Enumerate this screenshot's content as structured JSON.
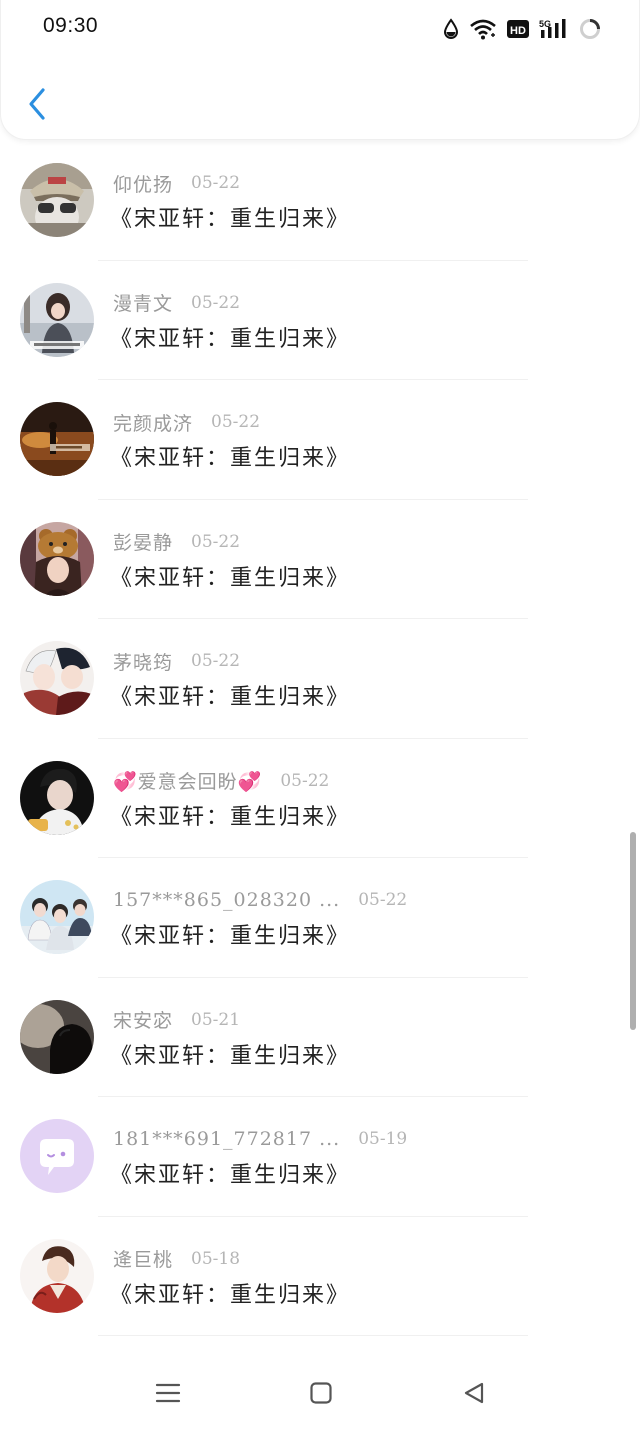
{
  "status_bar": {
    "time": "09:30",
    "icons": [
      "water-drop-icon",
      "wifi-icon",
      "hd-icon",
      "5g-signal-icon",
      "loading-ring-icon"
    ],
    "hd_label": "HD",
    "network_label": "5G"
  },
  "header": {
    "back_icon": "chevron-left-icon",
    "accent_color": "#2b8fe0"
  },
  "list": {
    "items": [
      {
        "name": "仰优扬",
        "date": "05-22",
        "title": "《宋亚轩：重生归来》",
        "avatar": "person-cap-sunglasses"
      },
      {
        "name": "漫青文",
        "date": "05-22",
        "title": "《宋亚轩：重生归来》",
        "avatar": "girl-winter-street"
      },
      {
        "name": "完颜成济",
        "date": "05-22",
        "title": "《宋亚轩：重生归来》",
        "avatar": "sunset-silhouette"
      },
      {
        "name": "彭晏静",
        "date": "05-22",
        "title": "《宋亚轩：重生归来》",
        "avatar": "girl-bear-hat"
      },
      {
        "name": "茅晓筠",
        "date": "05-22",
        "title": "《宋亚轩：重生归来》",
        "avatar": "anime-couple"
      },
      {
        "name": "💞爱意会回盼💞",
        "date": "05-22",
        "title": "《宋亚轩：重生归来》",
        "avatar": "boy-dark-portrait"
      },
      {
        "name": "157***865_028320 ...",
        "date": "05-22",
        "title": "《宋亚轩：重生归来》",
        "avatar": "anime-boys-group"
      },
      {
        "name": "宋安宓",
        "date": "05-21",
        "title": "《宋亚轩：重生归来》",
        "avatar": "dark-profile-silhouette"
      },
      {
        "name": "181***691_772817 ...",
        "date": "05-19",
        "title": "《宋亚轩：重生归来》",
        "avatar": "default-chat-bubble"
      },
      {
        "name": "逄巨桃",
        "date": "05-18",
        "title": "《宋亚轩：重生归来》",
        "avatar": "anime-boy-red-jacket"
      }
    ]
  },
  "nav_bar": {
    "icons": [
      "menu-lines-icon",
      "home-square-icon",
      "back-triangle-icon"
    ]
  }
}
